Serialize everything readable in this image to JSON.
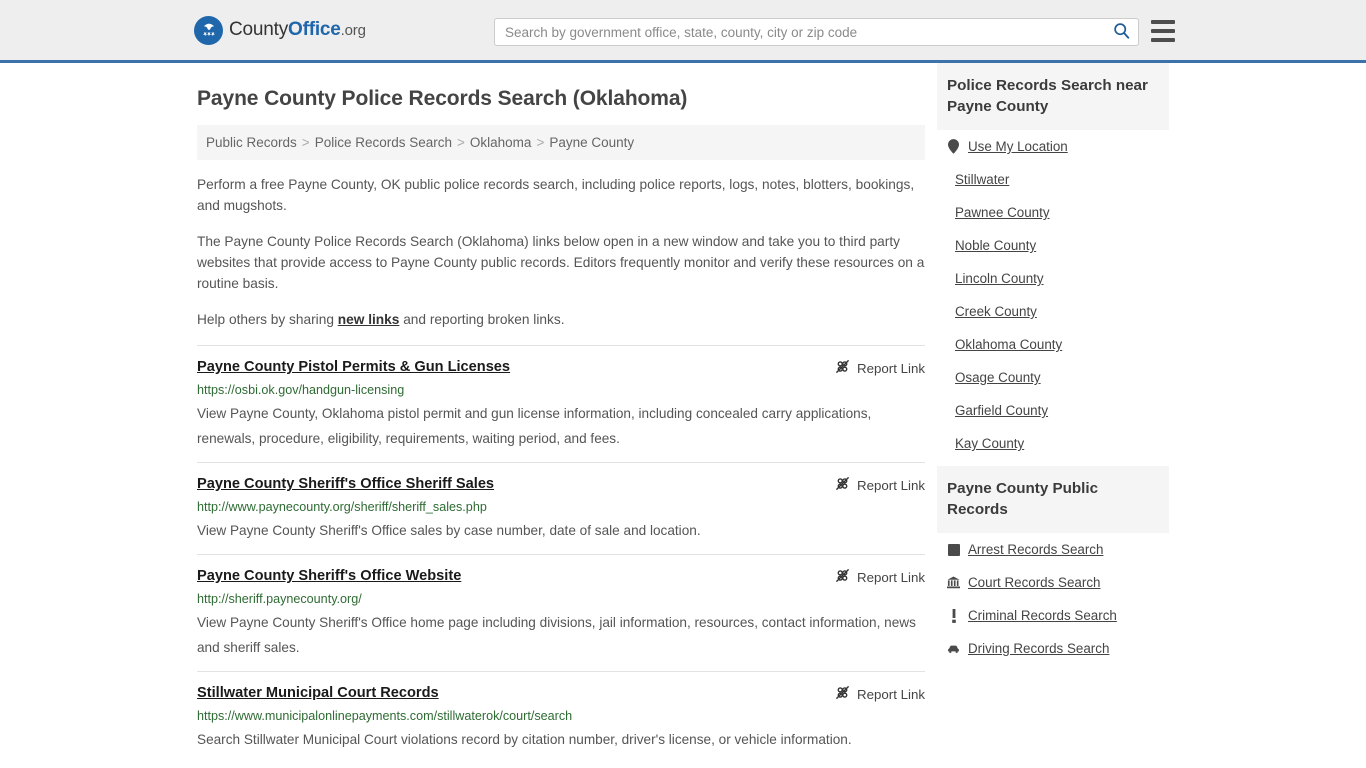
{
  "header": {
    "logo": {
      "icon": "eagle-shield-logo-icon",
      "text_county": "County",
      "text_office": "Office",
      "text_org": ".org"
    },
    "search": {
      "placeholder": "Search by government office, state, county, city or zip code",
      "value": "",
      "icon": "search-icon"
    },
    "menu_icon": "hamburger-menu-icon",
    "accent_color": "#3b73a8",
    "background_color": "#eeeeee"
  },
  "page_title": "Payne County Police Records Search (Oklahoma)",
  "breadcrumb": {
    "separator": ">",
    "items": [
      {
        "label": "Public Records"
      },
      {
        "label": "Police Records Search"
      },
      {
        "label": "Oklahoma"
      },
      {
        "label": "Payne County"
      }
    ]
  },
  "intro": {
    "p1": "Perform a free Payne County, OK public police records search, including police reports, logs, notes, blotters, bookings, and mugshots.",
    "p2": "The Payne County Police Records Search (Oklahoma) links below open in a new window and take you to third party websites that provide access to Payne County public records. Editors frequently monitor and verify these resources on a routine basis.",
    "p3_before": "Help others by sharing ",
    "p3_link": "new links",
    "p3_after": " and reporting broken links."
  },
  "report_link_label": "Report Link",
  "report_link_icon": "broken-link-icon",
  "results": [
    {
      "title": "Payne County Pistol Permits & Gun Licenses",
      "url": "https://osbi.ok.gov/handgun-licensing",
      "description": "View Payne County, Oklahoma pistol permit and gun license information, including concealed carry applications, renewals, procedure, eligibility, requirements, waiting period, and fees."
    },
    {
      "title": "Payne County Sheriff's Office Sheriff Sales",
      "url": "http://www.paynecounty.org/sheriff/sheriff_sales.php",
      "description": "View Payne County Sheriff's Office sales by case number, date of sale and location."
    },
    {
      "title": "Payne County Sheriff's Office Website",
      "url": "http://sheriff.paynecounty.org/",
      "description": "View Payne County Sheriff's Office home page including divisions, jail information, resources, contact information, news and sheriff sales."
    },
    {
      "title": "Stillwater Municipal Court Records",
      "url": "https://www.municipalonlinepayments.com/stillwaterok/court/search",
      "description": "Search Stillwater Municipal Court violations record by citation number, driver's license, or vehicle information."
    }
  ],
  "sidebar": {
    "nearby": {
      "heading": "Police Records Search near Payne County",
      "items": [
        {
          "label": "Use My Location",
          "icon": "map-pin-icon"
        },
        {
          "label": "Stillwater",
          "icon": ""
        },
        {
          "label": "Pawnee County",
          "icon": ""
        },
        {
          "label": "Noble County",
          "icon": ""
        },
        {
          "label": "Lincoln County",
          "icon": ""
        },
        {
          "label": "Creek County",
          "icon": ""
        },
        {
          "label": "Oklahoma County",
          "icon": ""
        },
        {
          "label": "Osage County",
          "icon": ""
        },
        {
          "label": "Garfield County",
          "icon": ""
        },
        {
          "label": "Kay County",
          "icon": ""
        }
      ]
    },
    "public_records": {
      "heading": "Payne County Public Records",
      "items": [
        {
          "label": "Arrest Records Search",
          "icon": "handcuffs-icon"
        },
        {
          "label": "Court Records Search",
          "icon": "courthouse-icon"
        },
        {
          "label": "Criminal Records Search",
          "icon": "exclamation-icon"
        },
        {
          "label": "Driving Records Search",
          "icon": "car-icon"
        }
      ]
    }
  },
  "colors": {
    "link_green": "#2e6b33",
    "text_gray": "#555555",
    "brand_blue": "#1f66ab"
  }
}
